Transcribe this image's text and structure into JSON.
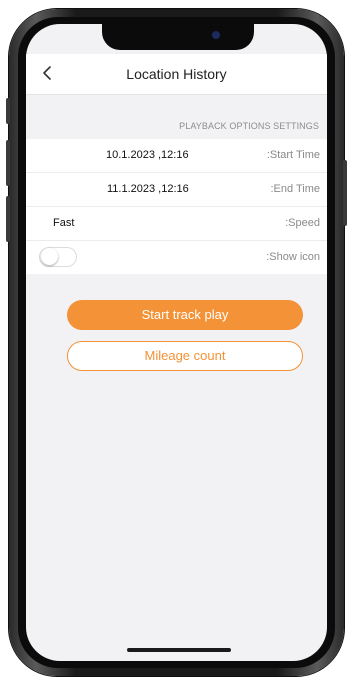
{
  "header": {
    "title": "Location History",
    "back_icon": "chevron-left-icon"
  },
  "section": {
    "title": "PLAYBACK OPTIONS SETTINGS"
  },
  "settings": {
    "start_time": {
      "label": ":Start Time",
      "value": "10.1.2023 ,12:16"
    },
    "end_time": {
      "label": ":End Time",
      "value": "11.1.2023 ,12:16"
    },
    "speed": {
      "label": ":Speed",
      "value": "Fast"
    },
    "show_icon": {
      "label": ":Show icon",
      "enabled": false
    }
  },
  "actions": {
    "start_track_play": "Start track play",
    "mileage_count": "Mileage count"
  },
  "colors": {
    "accent": "#f39237",
    "background": "#f2f2f4"
  }
}
